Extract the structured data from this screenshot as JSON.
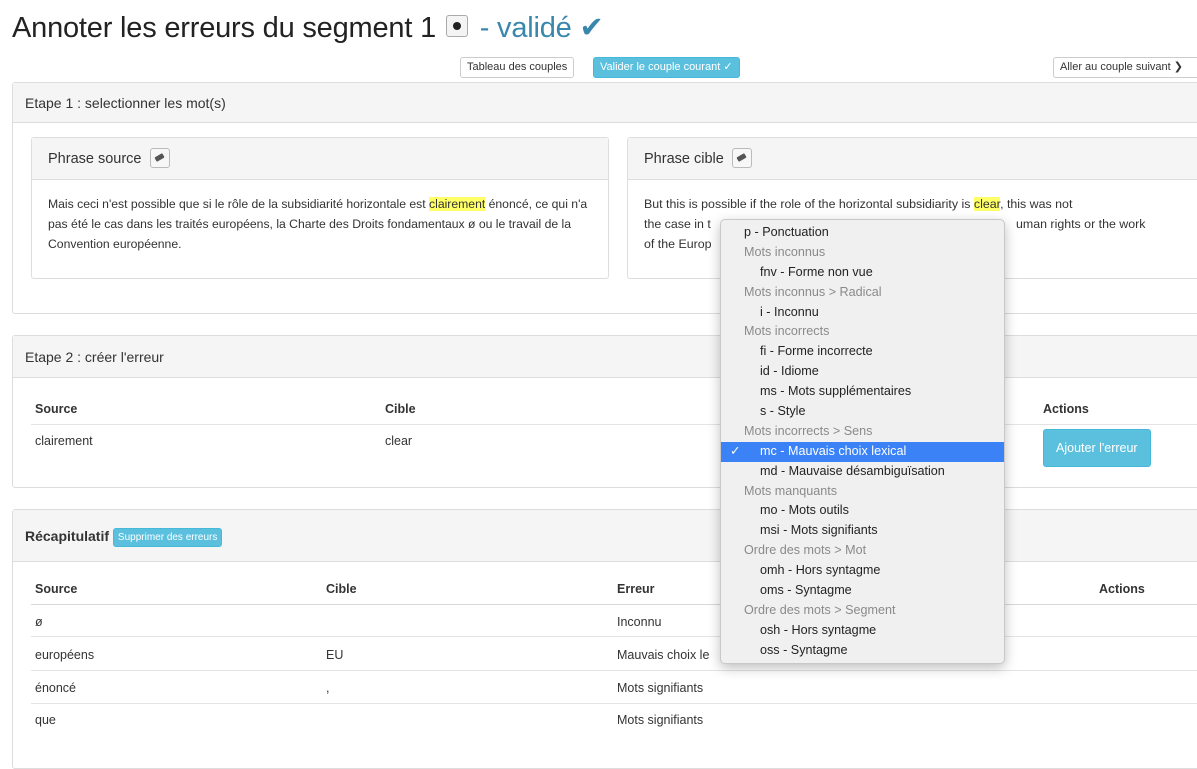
{
  "header": {
    "title": "Annoter les erreurs du segment 1",
    "status": "- validé",
    "check_glyph": "✔"
  },
  "toolbar": {
    "table_button": "Tableau des couples",
    "validate_button": "Valider le couple courant ✓",
    "next_button": "Aller au couple suivant ❯"
  },
  "step1": {
    "title": "Etape 1 : selectionner les mot(s)",
    "source": {
      "title": "Phrase source",
      "text_before": "Mais ceci n'est possible que si le rôle de la subsidiarité horizontale est ",
      "highlight": "clairement",
      "text_after": " énoncé, ce qui n'a pas été le cas dans les traités européens, la Charte des Droits fondamentaux ø ou le travail de la Convention européenne."
    },
    "target": {
      "title": "Phrase cible",
      "line1_before": "But this is possible if the role of the horizontal subsidiarity is ",
      "highlight": "clear",
      "line1_after": ", this was not",
      "line2_start": "the case in t",
      "line2_end": "uman rights or the work",
      "line3_start": "of the Europ"
    }
  },
  "step2": {
    "title": "Etape 2 : créer l'erreur",
    "columns": [
      "Source",
      "Cible",
      "Actions"
    ],
    "row": {
      "source": "clairement",
      "cible": "clear"
    },
    "add_button": "Ajouter l'erreur"
  },
  "recap": {
    "title": "Récapitulatif",
    "delete_button": "Supprimer des erreurs",
    "columns": [
      "Source",
      "Cible",
      "Erreur",
      "Actions"
    ],
    "rows": [
      {
        "source": "ø",
        "cible": "",
        "erreur": "Inconnu"
      },
      {
        "source": "européens",
        "cible": "EU",
        "erreur": "Mauvais choix le"
      },
      {
        "source": "énoncé",
        "cible": ",",
        "erreur": "Mots signifiants"
      },
      {
        "source": "que",
        "cible": "",
        "erreur": "Mots signifiants"
      }
    ]
  },
  "dropdown": {
    "items": [
      {
        "type": "option",
        "label": "p - Ponctuation",
        "indent": 0
      },
      {
        "type": "header",
        "label": "Mots inconnus"
      },
      {
        "type": "option",
        "label": "fnv - Forme non vue",
        "indent": 1
      },
      {
        "type": "header",
        "label": "Mots inconnus > Radical"
      },
      {
        "type": "option",
        "label": "i - Inconnu",
        "indent": 1
      },
      {
        "type": "header",
        "label": "Mots incorrects"
      },
      {
        "type": "option",
        "label": "fi - Forme incorrecte",
        "indent": 1
      },
      {
        "type": "option",
        "label": "id - Idiome",
        "indent": 1
      },
      {
        "type": "option",
        "label": "ms - Mots supplémentaires",
        "indent": 1
      },
      {
        "type": "option",
        "label": "s - Style",
        "indent": 1
      },
      {
        "type": "header",
        "label": "Mots incorrects > Sens"
      },
      {
        "type": "option",
        "label": "mc - Mauvais choix lexical",
        "indent": 1,
        "selected": true
      },
      {
        "type": "option",
        "label": "md - Mauvaise désambiguïsation",
        "indent": 1
      },
      {
        "type": "header",
        "label": "Mots manquants"
      },
      {
        "type": "option",
        "label": "mo - Mots outils",
        "indent": 1
      },
      {
        "type": "option",
        "label": "msi - Mots signifiants",
        "indent": 1
      },
      {
        "type": "header",
        "label": "Ordre des mots > Mot"
      },
      {
        "type": "option",
        "label": "omh - Hors syntagme",
        "indent": 1
      },
      {
        "type": "option",
        "label": "oms - Syntagme",
        "indent": 1
      },
      {
        "type": "header",
        "label": "Ordre des mots > Segment"
      },
      {
        "type": "option",
        "label": "osh - Hors syntagme",
        "indent": 1
      },
      {
        "type": "option",
        "label": "oss - Syntagme",
        "indent": 1
      }
    ],
    "check_glyph": "✓",
    "selected_color": "#3b82f7"
  },
  "colors": {
    "accent": "#3a87ad",
    "info_button": "#5bc0de",
    "highlight": "#ffff66"
  }
}
